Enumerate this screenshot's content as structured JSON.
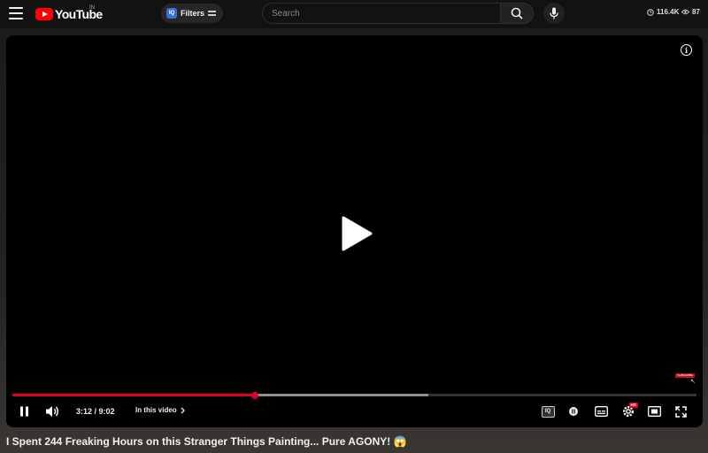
{
  "header": {
    "logo_text": "YouTube",
    "region": "IN",
    "filters_label": "Filters",
    "filters_icon_text": "IQ",
    "search_placeholder": "Search",
    "stat_clock": "116.4K",
    "stat_views": "87"
  },
  "player": {
    "subscribe_text": "SUBSCRIBE",
    "current_time": "3:12",
    "duration": "9:02",
    "time_display": "3:12 / 9:02",
    "played_fraction": 0.355,
    "buffered_fraction": 0.608,
    "in_this_video_label": "In this video",
    "iq_badge": "IQ",
    "hd_badge": "HD"
  },
  "video": {
    "title": "I Spent 244 Freaking Hours on this Stranger Things Painting... Pure AGONY! 😱"
  },
  "colors": {
    "accent_red": "#e5001f",
    "logo_red": "#ff0000",
    "filters_blue": "#3b6fd6"
  },
  "icons": [
    "menu-icon",
    "youtube-logo-icon",
    "filters-icon",
    "tune-icon",
    "search-icon",
    "mic-icon",
    "clock-icon",
    "eye-icon",
    "info-icon",
    "play-icon",
    "pause-icon",
    "volume-icon",
    "chevron-right-icon",
    "iq-icon",
    "record-icon",
    "subtitles-icon",
    "settings-icon",
    "miniplayer-icon",
    "fullscreen-icon"
  ]
}
